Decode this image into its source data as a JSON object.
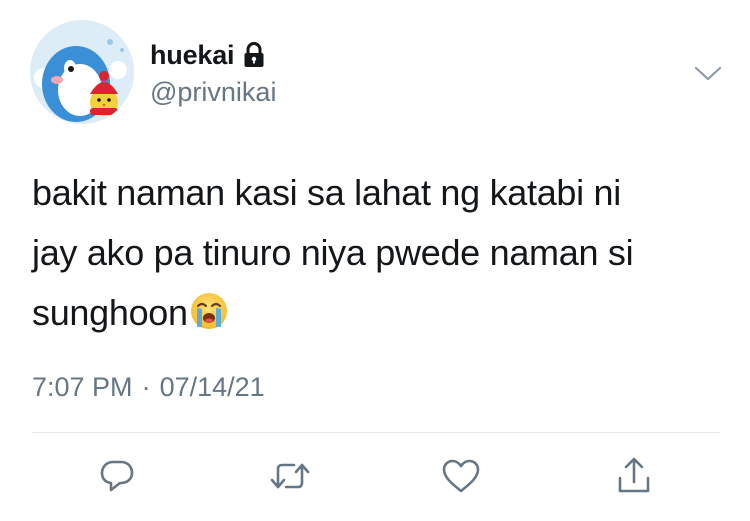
{
  "user": {
    "display_name": "huekai",
    "handle": "@privnikai",
    "protected": true
  },
  "tweet": {
    "lines": [
      "bakit naman kasi sa lahat ng katabi ni",
      "jay ako pa tinuro niya pwede naman si",
      "sunghoon"
    ],
    "emoji": "loudly-crying-face"
  },
  "meta": {
    "time": "7:07 PM",
    "separator": "·",
    "date": "07/14/21"
  },
  "actions": [
    "reply-icon",
    "retweet-icon",
    "like-icon",
    "share-icon"
  ],
  "colors": {
    "text": "#14171a",
    "secondary": "#657786",
    "divider": "#e1e8ed"
  }
}
